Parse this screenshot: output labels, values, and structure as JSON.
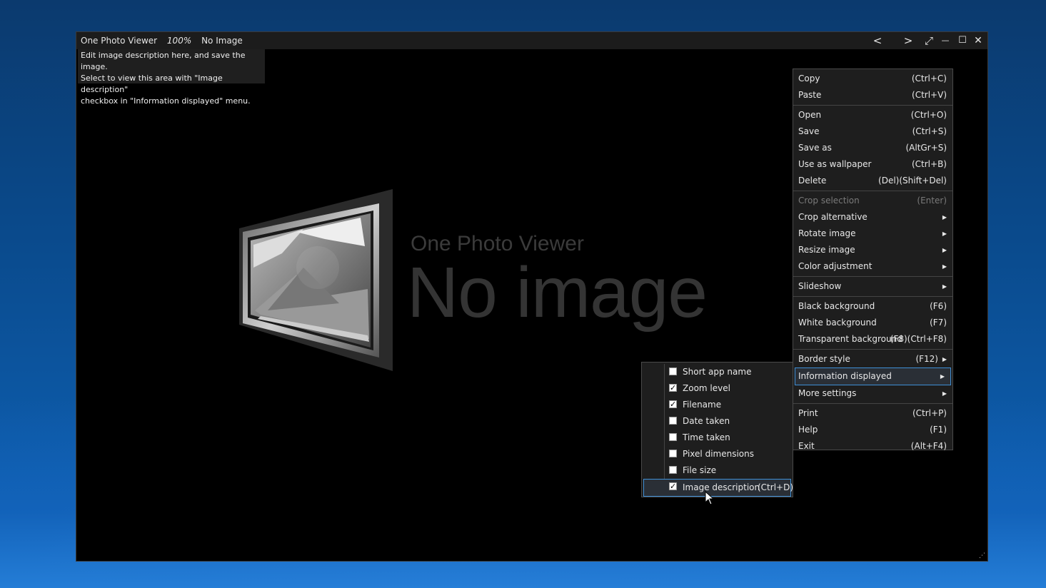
{
  "window": {
    "app_name": "One Photo Viewer",
    "zoom": "100%",
    "filename": "No Image",
    "prev_label": "<",
    "next_label": ">",
    "fullscreen_label": "⤢",
    "minimize_label": "—",
    "maximize_label": "☐",
    "close_label": "✕"
  },
  "description": {
    "line1": "Edit image description here, and save the image.",
    "line2": "Select to view this area with \"Image description\"",
    "line3": "checkbox in \"Information displayed\" menu."
  },
  "placeholder": {
    "app_name": "One Photo Viewer",
    "message": "No image"
  },
  "main_menu": {
    "copy": {
      "label": "Copy",
      "shortcut": "(Ctrl+C)"
    },
    "paste": {
      "label": "Paste",
      "shortcut": "(Ctrl+V)"
    },
    "open": {
      "label": "Open",
      "shortcut": "(Ctrl+O)"
    },
    "save": {
      "label": "Save",
      "shortcut": "(Ctrl+S)"
    },
    "save_as": {
      "label": "Save as",
      "shortcut": "(AltGr+S)"
    },
    "wallpaper": {
      "label": "Use as wallpaper",
      "shortcut": "(Ctrl+B)"
    },
    "delete": {
      "label": "Delete",
      "shortcut": "(Del)(Shift+Del)"
    },
    "crop_selection": {
      "label": "Crop selection",
      "shortcut": "(Enter)"
    },
    "crop_alternative": {
      "label": "Crop alternative"
    },
    "rotate": {
      "label": "Rotate image"
    },
    "resize": {
      "label": "Resize image"
    },
    "color": {
      "label": "Color adjustment"
    },
    "slideshow": {
      "label": "Slideshow"
    },
    "black_bg": {
      "label": "Black background",
      "shortcut": "(F6)"
    },
    "white_bg": {
      "label": "White background",
      "shortcut": "(F7)"
    },
    "transparent_bg": {
      "label": "Transparent background",
      "shortcut": "(F8)(Ctrl+F8)"
    },
    "border_style": {
      "label": "Border style",
      "shortcut": "(F12)"
    },
    "info_displayed": {
      "label": "Information displayed"
    },
    "more_settings": {
      "label": "More settings"
    },
    "print": {
      "label": "Print",
      "shortcut": "(Ctrl+P)"
    },
    "help": {
      "label": "Help",
      "shortcut": "(F1)"
    },
    "exit": {
      "label": "Exit",
      "shortcut": "(Alt+F4)"
    }
  },
  "info_menu": [
    {
      "label": "Short app name",
      "checked": false
    },
    {
      "label": "Zoom level",
      "checked": true
    },
    {
      "label": "Filename",
      "checked": true
    },
    {
      "label": "Date taken",
      "checked": false
    },
    {
      "label": "Time taken",
      "checked": false
    },
    {
      "label": "Pixel dimensions",
      "checked": false
    },
    {
      "label": "File size",
      "checked": false
    },
    {
      "label": "Image description",
      "checked": true,
      "shortcut": "(Ctrl+D)"
    }
  ],
  "colors": {
    "menu_bg": "#1e1e1e",
    "highlight_border": "#3f8fd6",
    "window_bg": "#000000",
    "titlebar_bg": "#1c1c1c"
  }
}
